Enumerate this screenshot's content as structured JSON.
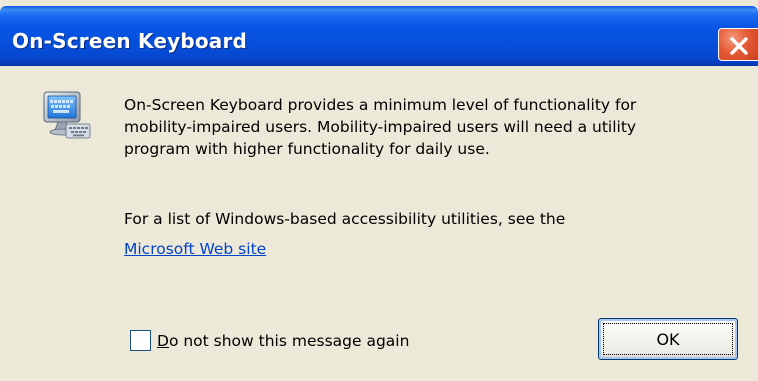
{
  "window": {
    "title": "On-Screen Keyboard",
    "close_icon": "close-icon"
  },
  "body": {
    "app_icon": "keyboard-monitor-icon",
    "message_line1": "On-Screen Keyboard provides a minimum level of functionality for",
    "message_line2": "mobility-impaired users. Mobility-impaired users will need a utility",
    "message_line3": "program with higher functionality for daily use.",
    "message_accessibility": "For a list of Windows-based accessibility utilities, see the",
    "link_text": "Microsoft Web site"
  },
  "footer": {
    "checkbox_mnemonic": "D",
    "checkbox_rest": "o not show this message again",
    "checkbox_checked": false,
    "ok_label": "OK"
  },
  "colors": {
    "titlebar": "#0650dc",
    "close_button": "#e55a36",
    "client_bg": "#ece9d8",
    "link": "#0044cc"
  }
}
